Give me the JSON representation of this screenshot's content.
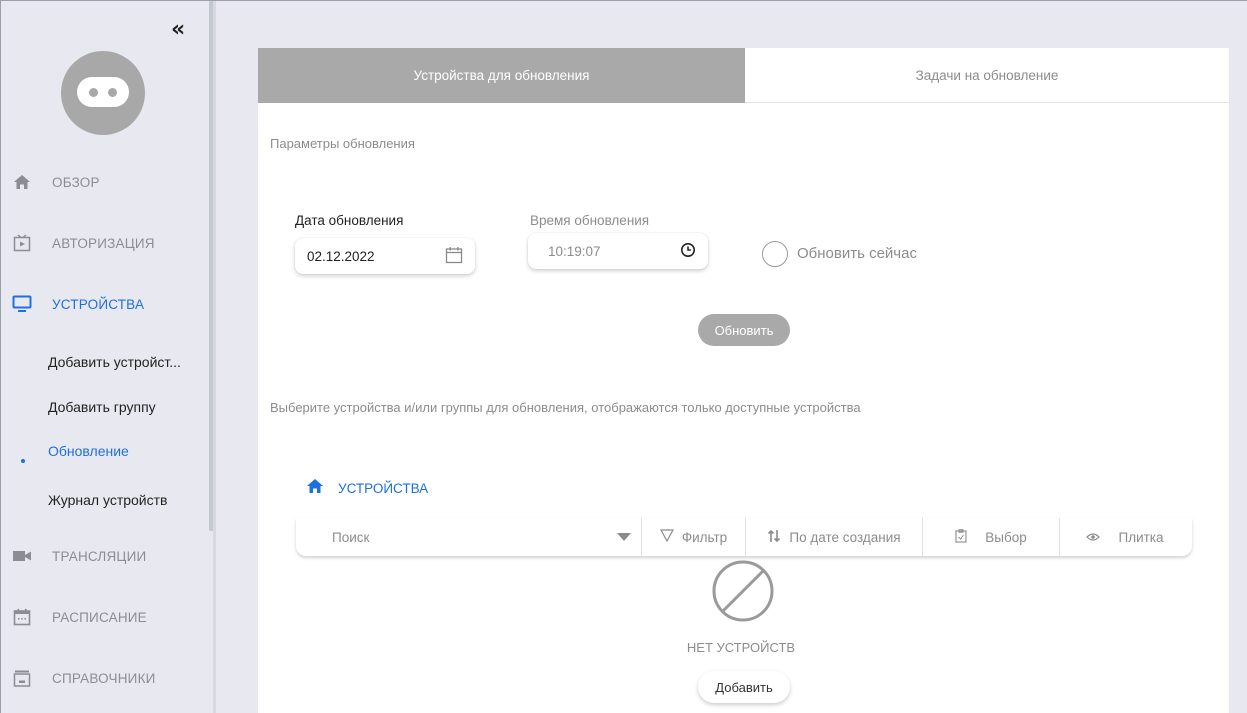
{
  "sidebar": {
    "collapse_glyph": "«",
    "nav": [
      {
        "label": "ОБЗОР",
        "icon": "home-icon"
      },
      {
        "label": "АВТОРИЗАЦИЯ",
        "icon": "auth-icon"
      },
      {
        "label": "УСТРОЙСТВА",
        "icon": "monitor-icon"
      },
      {
        "label": "ТРАНСЛЯЦИИ",
        "icon": "camera-icon"
      },
      {
        "label": "РАСПИСАНИЕ",
        "icon": "calendar-icon"
      },
      {
        "label": "СПРАВОЧНИКИ",
        "icon": "folder-icon"
      }
    ],
    "sub": [
      {
        "label": "Добавить устройст..."
      },
      {
        "label": "Добавить группу"
      },
      {
        "label": "Обновление"
      },
      {
        "label": "Журнал устройств"
      }
    ],
    "colors": {
      "active": "#1e6fe0",
      "muted": "#8a8d94"
    }
  },
  "tabs": [
    {
      "label": "Устройства для обновления"
    },
    {
      "label": "Задачи на обновление"
    }
  ],
  "params": {
    "title": "Параметры обновления",
    "date_label": "Дата обновления",
    "date_value": "02.12.2022",
    "time_label": "Время обновления",
    "time_value": "10:19:07",
    "now_label": "Обновить сейчас",
    "update_button": "Обновить"
  },
  "devices": {
    "hint": "Выберите устройства и/или группы для обновления, отображаются только доступные устройства",
    "breadcrumb": "УСТРОЙСТВА",
    "search_placeholder": "Поиск",
    "filter_label": "Фильтр",
    "sort_label": "По дате создания",
    "select_label": "Выбор",
    "view_label": "Плитка",
    "empty_text": "НЕТ УСТРОЙСТВ",
    "add_button": "Добавить"
  }
}
